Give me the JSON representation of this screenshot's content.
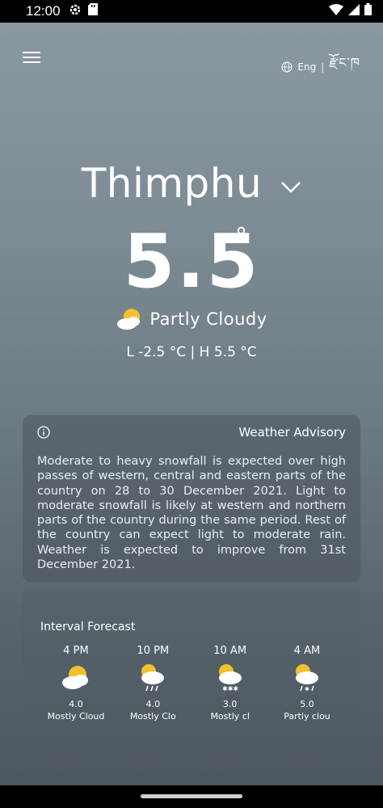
{
  "status_bar": {
    "time": "12:00"
  },
  "header": {
    "language": "Eng",
    "separator": "|",
    "dzongkha": "རྫོང་ཁ"
  },
  "city": {
    "name": "Thimphu"
  },
  "current": {
    "temperature": "5.5",
    "degree": "°",
    "condition": "Partly Cloudy",
    "low_high": "L -2.5 °C  |  H 5.5 °C"
  },
  "advisory": {
    "title": "Weather Advisory",
    "body": "Moderate to heavy snowfall is expected over high passes of western, central and eastern parts of the country on 28 to 30 December 2021. Light to moderate snowfall is likely at western and northern parts of the country during the same period. Rest of the country can expect light to moderate rain. Weather is expected to improve from 31st December 2021."
  },
  "forecast": {
    "title": "Interval Forecast",
    "items": [
      {
        "time": "4 PM",
        "value": "4.0",
        "desc": "Mostly Cloud",
        "icon": "partly-cloudy-icon"
      },
      {
        "time": "10 PM",
        "value": "4.0",
        "desc": "Mostly Clo",
        "icon": "rain-cloud-icon"
      },
      {
        "time": "10 AM",
        "value": "3.0",
        "desc": "Mostly cl",
        "icon": "snow-cloud-icon"
      },
      {
        "time": "4 AM",
        "value": "5.0",
        "desc": "Partly clou",
        "icon": "snow-rain-cloud-icon"
      }
    ]
  }
}
